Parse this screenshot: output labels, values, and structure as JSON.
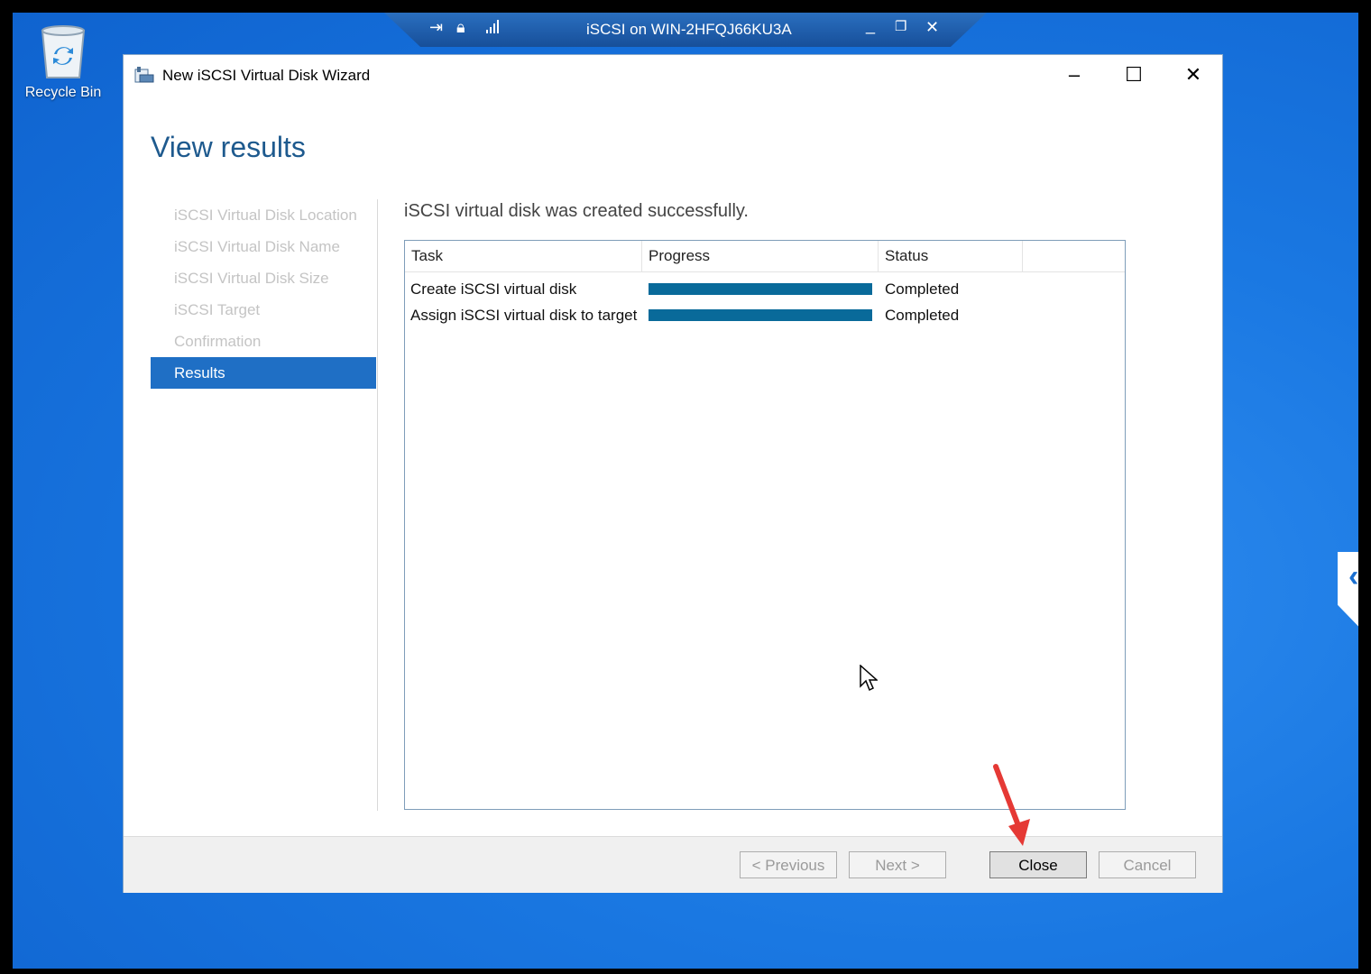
{
  "desktop": {
    "recycle_bin_label": "Recycle Bin"
  },
  "rdp_bar": {
    "title": "iSCSI on WIN-2HFQJ66KU3A"
  },
  "window": {
    "title": "New iSCSI Virtual Disk Wizard",
    "heading": "View results"
  },
  "steps": [
    {
      "label": "iSCSI Virtual Disk Location",
      "active": false
    },
    {
      "label": "iSCSI Virtual Disk Name",
      "active": false
    },
    {
      "label": "iSCSI Virtual Disk Size",
      "active": false
    },
    {
      "label": "iSCSI Target",
      "active": false
    },
    {
      "label": "Confirmation",
      "active": false
    },
    {
      "label": "Results",
      "active": true
    }
  ],
  "results": {
    "message": "iSCSI virtual disk was created successfully.",
    "columns": [
      "Task",
      "Progress",
      "Status"
    ],
    "rows": [
      {
        "task": "Create iSCSI virtual disk",
        "progress": 100,
        "status": "Completed"
      },
      {
        "task": "Assign iSCSI virtual disk to target",
        "progress": 100,
        "status": "Completed"
      }
    ]
  },
  "buttons": {
    "previous": "< Previous",
    "next": "Next >",
    "close": "Close",
    "cancel": "Cancel"
  },
  "colors": {
    "accent": "#1f6fc5",
    "progress_fill": "#096a9a",
    "annotation_arrow": "#e53935"
  }
}
